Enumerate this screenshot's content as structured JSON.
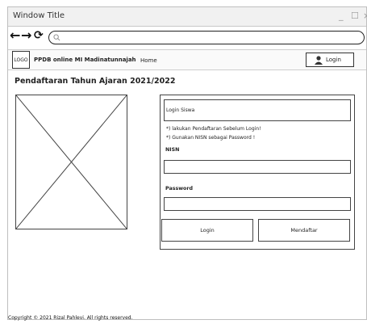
{
  "window": {
    "title": "Window Title",
    "minimize": "_",
    "maximize": "☐",
    "close": "×"
  },
  "browser": {
    "back": "←",
    "forward": "→",
    "reload": "⟳",
    "address_value": ""
  },
  "appbar": {
    "logo_text": "LOGO",
    "brand": "PPDB online MI Madinatunnajah",
    "home": "Home",
    "login": "Login"
  },
  "page": {
    "heading": "Pendaftaran Tahun Ajaran 2021/2022"
  },
  "login_form": {
    "title": "Login Siswa",
    "note1": "*) lakukan Pendaftaran Sebelum Login!",
    "note2": "*) Gunakan NISN sebagai Password !",
    "nisn_label": "NISN",
    "nisn_value": "",
    "password_label": "Password",
    "password_value": "",
    "login_button": "Login",
    "register_button": "Mendaftar"
  },
  "footer": {
    "copyright": "Copyright © 2021 Rizal Pahlevi. All rights reserved."
  }
}
